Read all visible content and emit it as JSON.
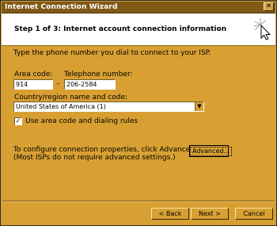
{
  "window": {
    "title": "Internet Connection Wizard"
  },
  "header": {
    "step_text": "Step 1 of 3: Internet account connection information"
  },
  "content": {
    "instruction": "Type the phone number you dial to connect to your ISP.",
    "area_code": {
      "label": "Area code:",
      "value": "914"
    },
    "telephone": {
      "label": "Telephone number:",
      "value": "206-2584"
    },
    "dash": "–",
    "country": {
      "label": "Country/region name and code:",
      "selected": "United States of America (1)"
    },
    "use_area_code": {
      "label": "Use area code and dialing rules",
      "checked": true
    },
    "advanced_note_1": "To configure connection properties, click Advanced.",
    "advanced_note_2": "(Most ISPs do not require advanced settings.)",
    "advanced_button": "Advanced..."
  },
  "buttons": {
    "back": "< Back",
    "next": "Next >",
    "cancel": "Cancel"
  },
  "icons": {
    "close": "close-icon",
    "wizard": "wizard-wand-icon",
    "dropdown": "chevron-down-icon",
    "check": "checkmark-icon"
  },
  "colors": {
    "window_bg": "#d8a033",
    "titlebar": "#7f5a16",
    "header_bg": "#ffffff"
  }
}
